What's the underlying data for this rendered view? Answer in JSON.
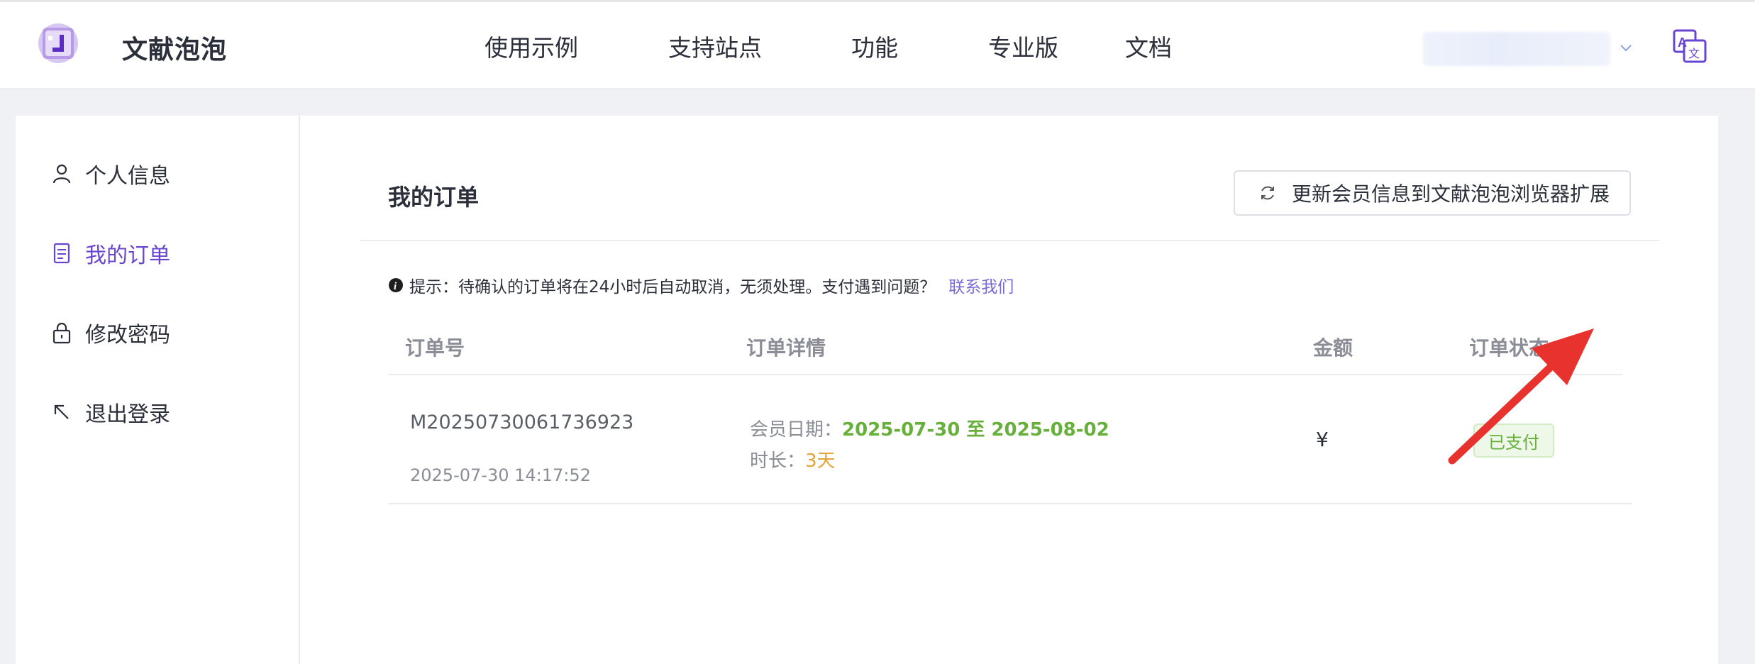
{
  "header": {
    "brand": "文献泡泡",
    "nav": [
      "使用示例",
      "支持站点",
      "功能",
      "专业版",
      "文档"
    ],
    "logo_icon": "bubble-logo-icon",
    "lang_icon": "translate-icon",
    "accent_color": "#6a45d0"
  },
  "sidebar": {
    "items": [
      {
        "label": "个人信息",
        "icon": "user-icon",
        "active": false
      },
      {
        "label": "我的订单",
        "icon": "document-icon",
        "active": true
      },
      {
        "label": "修改密码",
        "icon": "lock-icon",
        "active": false
      },
      {
        "label": "退出登录",
        "icon": "arrow-up-left-icon",
        "active": false
      }
    ]
  },
  "main": {
    "title": "我的订单",
    "sync_button": "更新会员信息到文献泡泡浏览器扩展",
    "tip": {
      "text": "提示：待确认的订单将在24小时后自动取消，无须处理。支付遇到问题？",
      "link": "联系我们"
    },
    "table": {
      "headers": [
        "订单号",
        "订单详情",
        "金额",
        "订单状态"
      ],
      "rows": [
        {
          "order_no": "M20250730061736923",
          "time": "2025-07-30 14:17:52",
          "member_date_label": "会员日期：",
          "member_date": "2025-07-30 至 2025-08-02",
          "duration_label": "时长：",
          "duration": "3天",
          "amount": "¥",
          "status": "已支付"
        }
      ]
    }
  }
}
